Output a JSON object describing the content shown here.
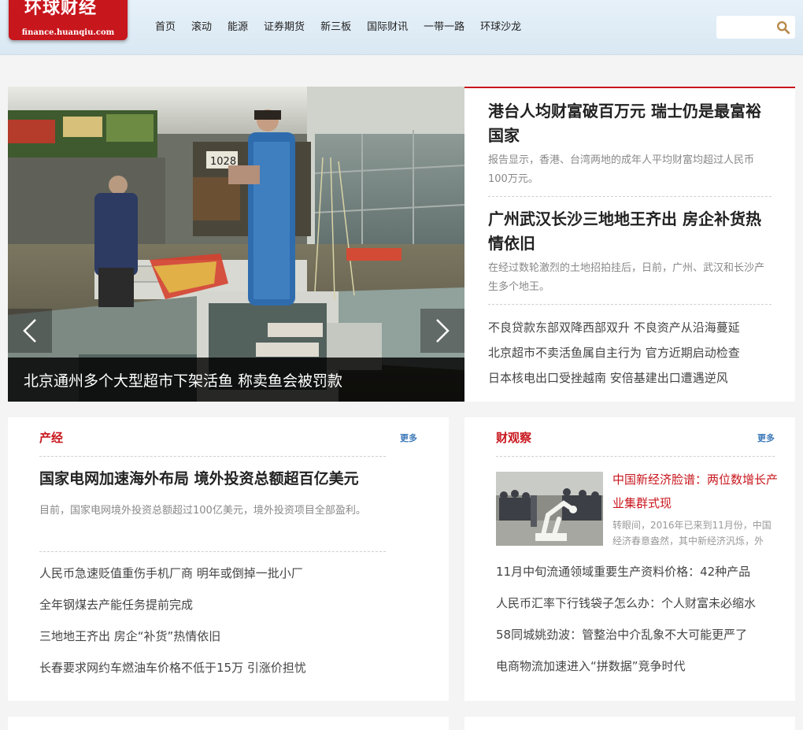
{
  "header": {
    "logo_text": "环球财经",
    "logo_domain": "finance.huanqiu.com",
    "nav": [
      "首页",
      "滚动",
      "能源",
      "证券期货",
      "新三板",
      "国际财讯",
      "一带一路",
      "环球沙龙"
    ],
    "search_placeholder": "",
    "search_icon": "search-icon"
  },
  "slider": {
    "caption": "北京通州多个大型超市下架活鱼 称卖鱼会被罚款",
    "prev_icon": "chevron-left-icon",
    "next_icon": "chevron-right-icon",
    "photo_sign": "1028"
  },
  "top_news": {
    "items": [
      {
        "title": "港台人均财富破百万元 瑞士仍是最富裕国家",
        "desc": "报告显示，香港、台湾两地的成年人平均财富均超过人民币100万元。"
      },
      {
        "title": "广州武汉长沙三地地王齐出 房企补货热情依旧",
        "desc": "在经过数轮激烈的土地招拍挂后，日前，广州、武汉和长沙产生多个地王。"
      }
    ],
    "list": [
      "不良贷款东部双降西部双升 不良资产从沿海蔓延",
      "北京超市不卖活鱼属自主行为 官方近期启动检查",
      "日本核电出口受挫越南 安倍基建出口遭遇逆风"
    ]
  },
  "panel_chanjing": {
    "title": "产经",
    "more": "更多",
    "headline": "国家电网加速海外布局 境外投资总额超百亿美元",
    "desc": "目前，国家电网境外投资总额超过100亿美元，境外投资项目全部盈利。",
    "list": [
      "人民币急速贬值重伤手机厂商 明年或倒掉一批小厂",
      "全年钢煤去产能任务提前完成",
      "三地地王齐出 房企“补货”热情依旧",
      "长春要求网约车燃油车价格不低于15万 引涨价担忧"
    ]
  },
  "panel_caiguancha": {
    "title": "财观察",
    "more": "更多",
    "feature_title": "中国新经济脸谱：两位数增长产业集群式现",
    "feature_desc": "转眼间，2016年已来到11月份，中国经济春意盎然，其中新经济汎烁，外",
    "list": [
      "11月中旬流通领域重要生产资料价格：42种产品",
      "人民币汇率下行钱袋子怎么办：个人财富未必缩水",
      "58同城姚劲波：管整治中介乱象不大可能更严了",
      "电商物流加速进入“拼数据”竞争时代"
    ]
  },
  "colors": {
    "brand_red": "#c8161d",
    "more_blue": "#3b78b8",
    "header_bg": "#dde9f3"
  }
}
